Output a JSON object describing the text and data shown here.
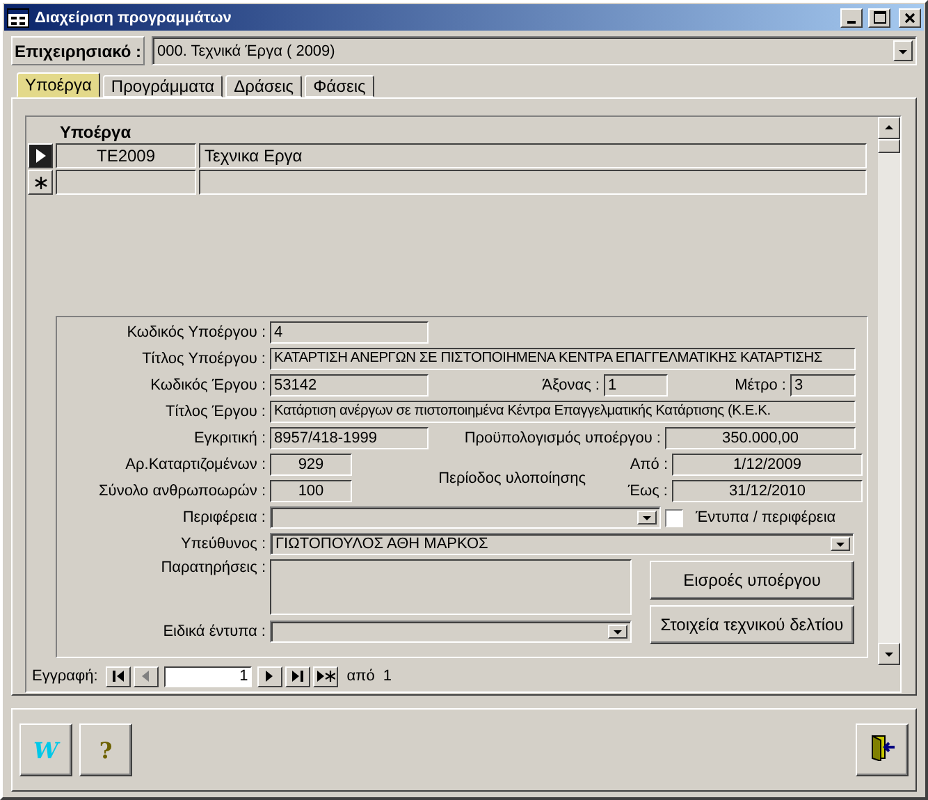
{
  "window": {
    "title": "Διαχείριση προγραμμάτων"
  },
  "program": {
    "label": "Επιχειρησιακό :",
    "value": "000. Τεχνικά Έργα ( 2009)"
  },
  "tabs": [
    {
      "label": "Υποέργα",
      "selected": true
    },
    {
      "label": "Προγράμματα",
      "selected": false
    },
    {
      "label": "Δράσεις",
      "selected": false
    },
    {
      "label": "Φάσεις",
      "selected": false
    }
  ],
  "subform": {
    "heading": "Υποέργα",
    "rows": [
      {
        "kind": "current",
        "code": "TE2009",
        "title": "Τεχνικα Εργα"
      },
      {
        "kind": "new"
      }
    ]
  },
  "detail": {
    "code": {
      "label": "Κωδικός Υποέργου :",
      "value": "4"
    },
    "title": {
      "label": "Τίτλος Υποέργου :",
      "value": "ΚΑΤΑΡΤΙΣΗ ΑΝΕΡΓΩΝ ΣΕ ΠΙΣΤΟΠΟΙΗΜΕΝΑ ΚΕΝΤΡΑ ΕΠΑΓΓΕΛΜΑΤΙΚΗΣ ΚΑΤΑΡΤΙΣΗΣ"
    },
    "project_code": {
      "label": "Κωδικός Έργου :",
      "value": "53142"
    },
    "axis": {
      "label": "Άξονας :",
      "value": "1"
    },
    "measure": {
      "label": "Μέτρο :",
      "value": "3"
    },
    "project_title": {
      "label": "Τίτλος Έργου :",
      "value": "Κατάρτιση ανέργων σε πιστοποιημένα Κέντρα Επαγγελματικής Κατάρτισης (Κ.Ε.Κ."
    },
    "approval": {
      "label": "Εγκριτική :",
      "value": "8957/418-1999"
    },
    "budget": {
      "label": "Προϋπολογισμός υποέργου :",
      "value": "350.000,00"
    },
    "trainees": {
      "label": "Αρ.Καταρτιζομένων :",
      "value": "929"
    },
    "hours": {
      "label": "Σύνολο ανθρωποωρών :",
      "value": "100"
    },
    "period": {
      "label": "Περίοδος υλοποίησης",
      "from_label": "Από :",
      "from": "1/12/2009",
      "to_label": "Έως :",
      "to": "31/12/2010"
    },
    "region": {
      "label": "Περιφέρεια :"
    },
    "forms_per_region": {
      "label": "Έντυπα / περιφέρεια",
      "checked": false
    },
    "manager": {
      "label": "Υπεύθυνος :",
      "value": "ΓΙΩΤΟΠΟΥΛΟΣ ΑΘΗ ΜΑΡΚΟΣ"
    },
    "notes": {
      "label": "Παρατηρήσεις :"
    },
    "special_forms": {
      "label": "Ειδικά έντυπα :"
    },
    "buttons": [
      "Εισροές υποέργου",
      "Στοιχεία τεχνικού δελτίου"
    ]
  },
  "navigation": {
    "label": "Εγγραφή:",
    "current": "1",
    "of": "από",
    "total": "1"
  },
  "toolbar": {
    "word_label": "W",
    "help_label": "?"
  }
}
